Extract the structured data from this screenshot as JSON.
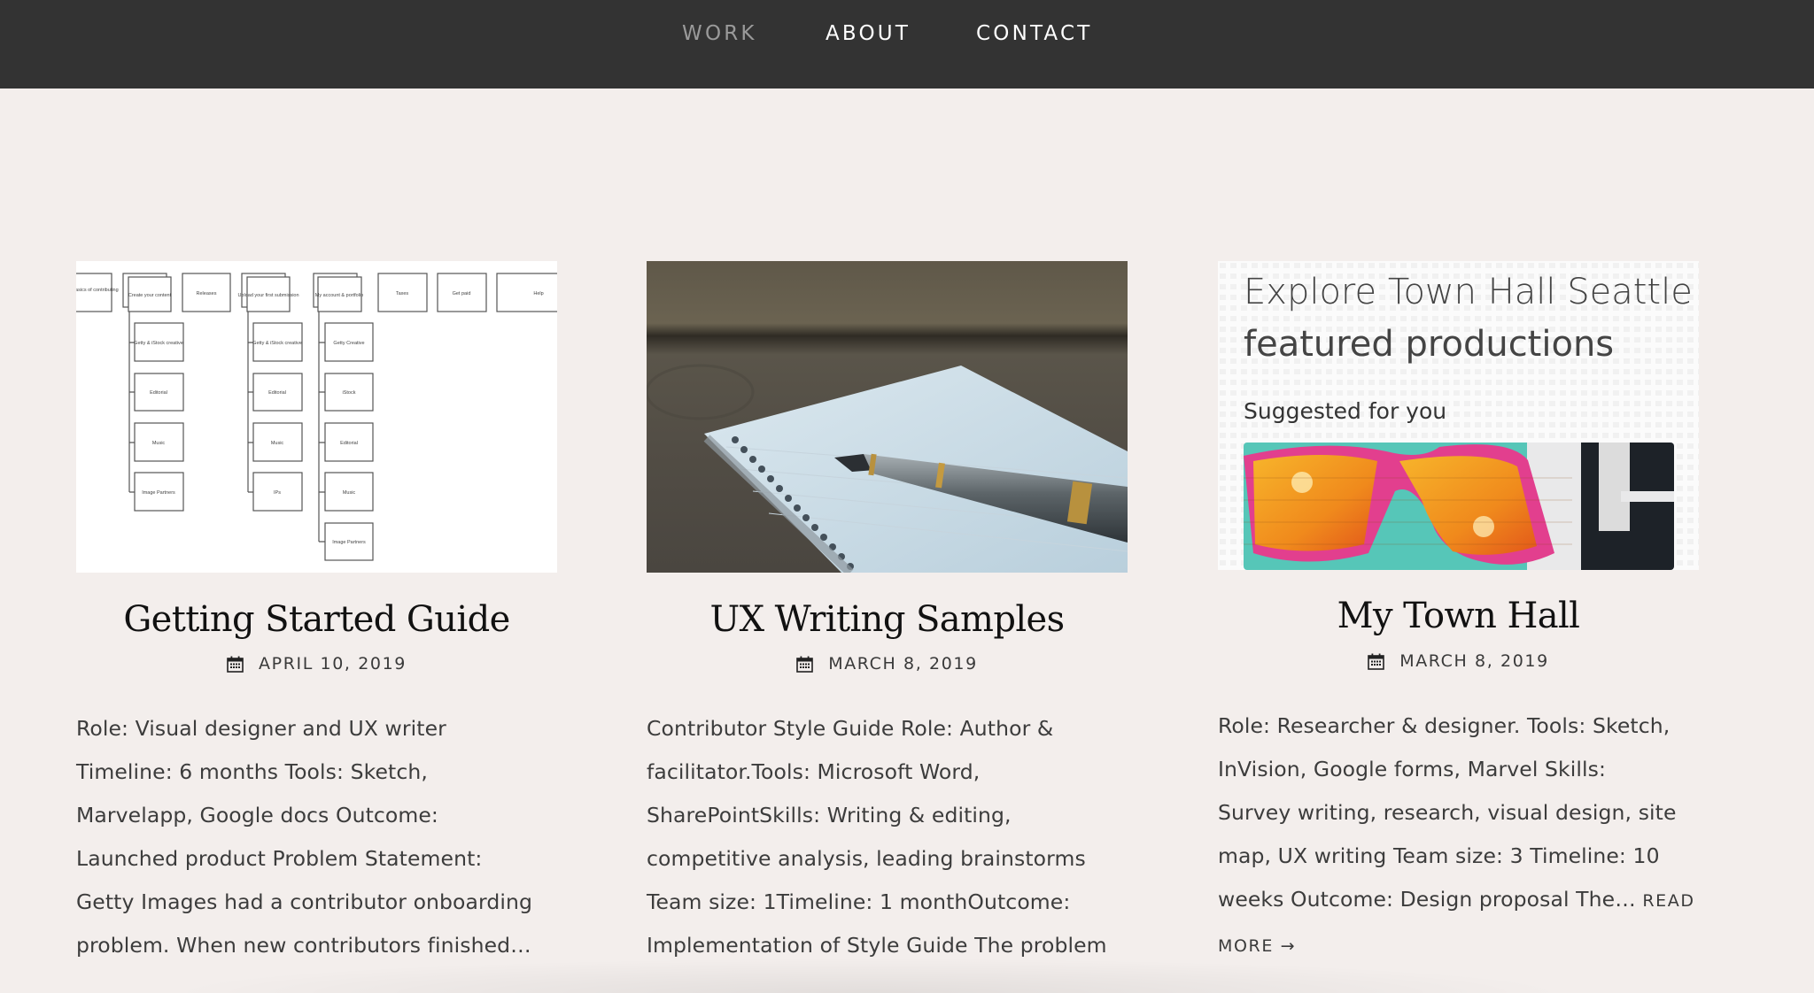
{
  "nav": {
    "items": [
      {
        "label": "WORK",
        "active": true
      },
      {
        "label": "ABOUT",
        "active": false
      },
      {
        "label": "CONTACT",
        "active": false
      }
    ]
  },
  "colors": {
    "nav_bg": "#333333",
    "page_bg": "#f3eeec",
    "nav_active": "#9a9a9a",
    "nav_text": "#ffffff"
  },
  "cards": [
    {
      "title": "Getting Started Guide",
      "date": "APRIL 10, 2019",
      "date_icon": "calendar-icon",
      "image": {
        "type": "sitemap-diagram",
        "top_row": [
          "he basics of contributing",
          "Create your content",
          "Releases",
          "Upload your first submission",
          "My account & portfolio",
          "Taxes",
          "Get paid",
          "Help"
        ],
        "branch_create": [
          "Getty & iStock creative",
          "Editorial",
          "Music",
          "Image Partners"
        ],
        "branch_upload": [
          "Getty & iStock creative",
          "Editorial",
          "Music",
          "IPs"
        ],
        "branch_account": [
          "Getty Creative",
          "iStock",
          "Editorial",
          "Music",
          "Image Partners"
        ]
      },
      "excerpt_lines": [
        "Role: Visual designer and UX writer",
        "Timeline: 6 months Tools: Sketch,",
        "Marvelapp, Google docs Outcome:",
        "Launched product Problem Statement:",
        "Getty Images had a contributor onboarding",
        "problem. When new contributors finished…"
      ]
    },
    {
      "title": "UX Writing Samples",
      "date": "MARCH 8, 2019",
      "date_icon": "calendar-icon",
      "image": {
        "type": "photo",
        "description": "fountain pen on spiral notebook on wooden table"
      },
      "excerpt_lines": [
        "Contributor Style Guide Role: Author &",
        "facilitator.Tools: Microsoft Word,",
        "SharePointSkills: Writing & editing,",
        "competitive analysis, leading brainstorms",
        "Team size: 1Timeline: 1 monthOutcome:",
        "Implementation of Style Guide The problem"
      ]
    },
    {
      "title": "My Town Hall",
      "date": "MARCH 8, 2019",
      "date_icon": "calendar-icon",
      "image": {
        "type": "app-screenshot",
        "heading_line1": "Explore Town Hall Seattle",
        "heading_line2": "featured productions",
        "subheading": "Suggested for you"
      },
      "excerpt_lines": [
        "Role: Researcher & designer. Tools: Sketch,",
        "InVision, Google forms, Marvel Skills:",
        "Survey writing, research, visual design, site",
        "map, UX writing Team size: 3 Timeline: 10",
        "weeks Outcome: Design proposal The…"
      ],
      "read_more_part1": "READ",
      "read_more_part2": "MORE →"
    }
  ]
}
